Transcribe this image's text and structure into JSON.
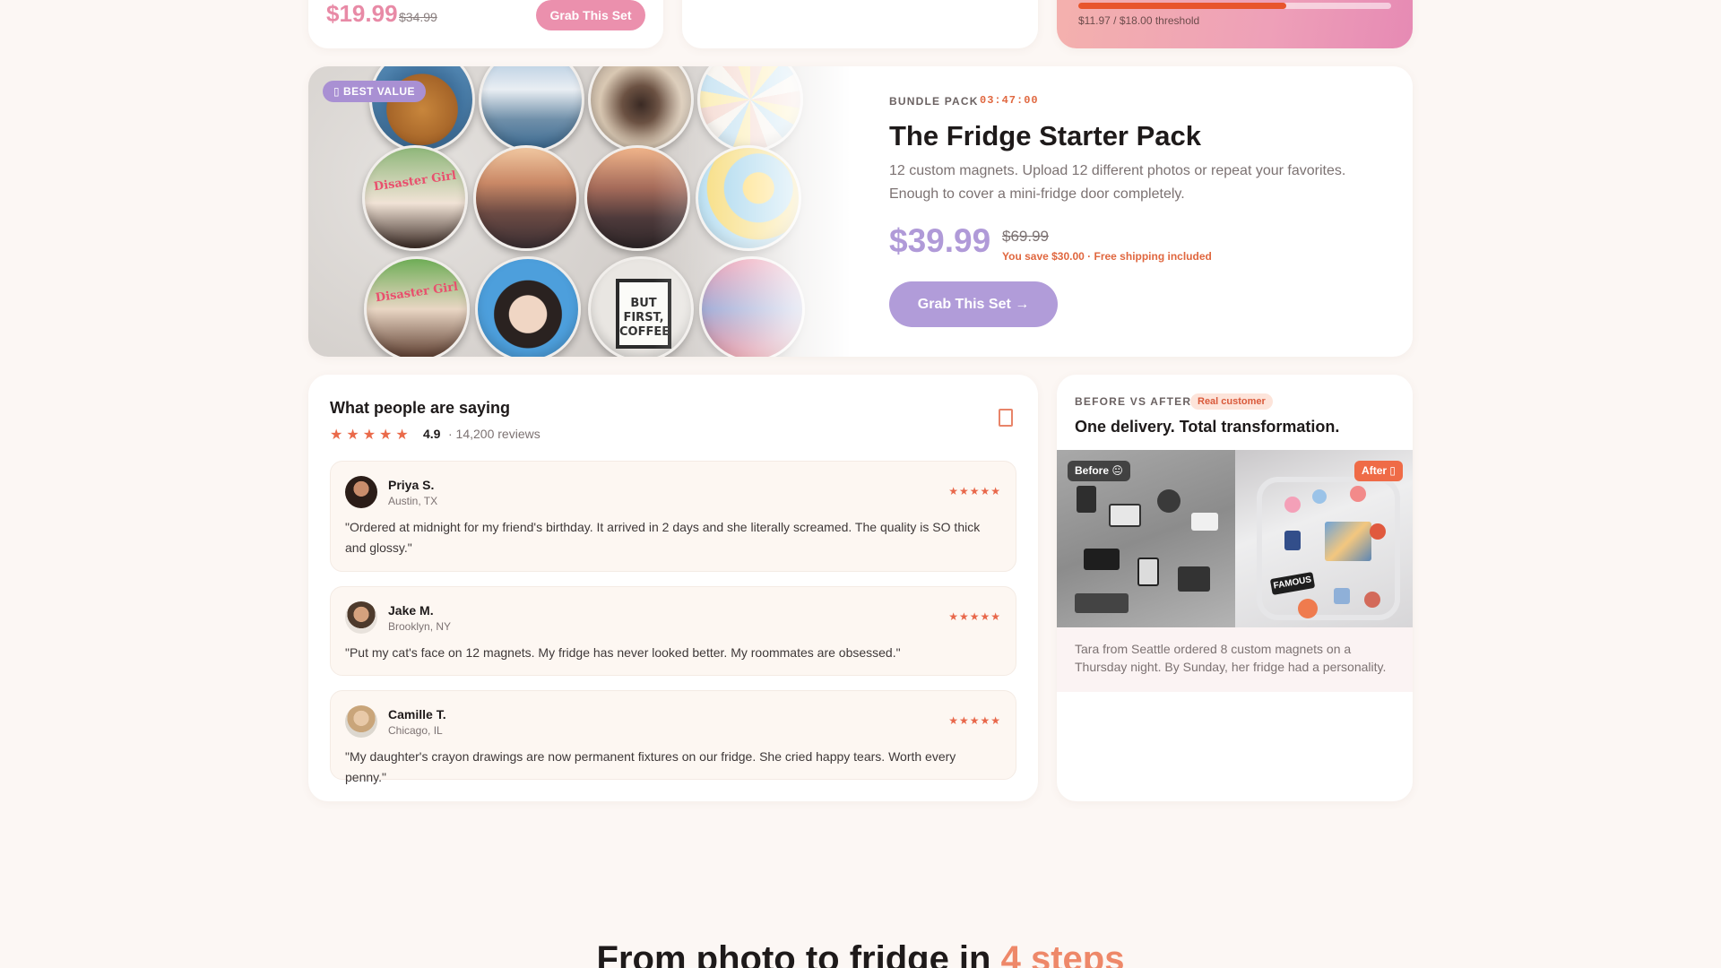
{
  "top_left": {
    "price": "$19.99",
    "old_price": "$34.99",
    "button": "Grab This Set"
  },
  "top_right": {
    "progress": 0.665,
    "threshold": "$11.97 / $18.00 threshold"
  },
  "bundle": {
    "badge": "▯ BEST VALUE",
    "eyebrow": "BUNDLE PACK",
    "timer": "03:47:00",
    "title": "The Fridge Starter Pack",
    "description": "12 custom magnets. Upload 12 different photos or repeat your favorites. Enough to cover a mini-fridge door completely.",
    "price": "$39.99",
    "old_price": "$69.99",
    "savings": "You save $30.00 · Free shipping included",
    "button": "Grab This Set →",
    "magnet_captions": {
      "disaster_girl": "Disaster Girl",
      "sign": "BUT FIRST, COFFEE"
    }
  },
  "reviews": {
    "title": "What people are saying",
    "stars": "★★★★★",
    "rating": "4.9",
    "count": "· 14,200 reviews",
    "items": [
      {
        "name": "Priya S.",
        "location": "Austin, TX",
        "stars": "★★★★★",
        "quote": "\"Ordered at midnight for my friend's birthday. It arrived in 2 days and she literally screamed. The quality is SO thick and glossy.\""
      },
      {
        "name": "Jake M.",
        "location": "Brooklyn, NY",
        "stars": "★★★★★",
        "quote": "\"Put my cat's face on 12 magnets. My fridge has never looked better. My roommates are obsessed.\""
      },
      {
        "name": "Camille T.",
        "location": "Chicago, IL",
        "stars": "★★★★★",
        "quote": "\"My daughter's crayon drawings are now permanent fixtures on our fridge. She cried happy tears. Worth every penny.\""
      }
    ]
  },
  "before_after": {
    "eyebrow": "BEFORE VS AFTER",
    "tag": "Real customer",
    "title": "One delivery. Total transformation.",
    "before_label": "Before 😐",
    "after_label": "After ▯",
    "after_sticker": "FAMOUS",
    "caption": "Tara from Seattle ordered 8 custom magnets on a Thursday night. By Sunday, her fridge had a personality."
  },
  "section": {
    "heading_main": "From photo to fridge in ",
    "heading_accent": "4 steps"
  },
  "colors": {
    "accent_pink": "#eb90ad",
    "accent_purple": "#b19cd9",
    "accent_orange": "#e0673f",
    "background": "#fcf7f4"
  }
}
